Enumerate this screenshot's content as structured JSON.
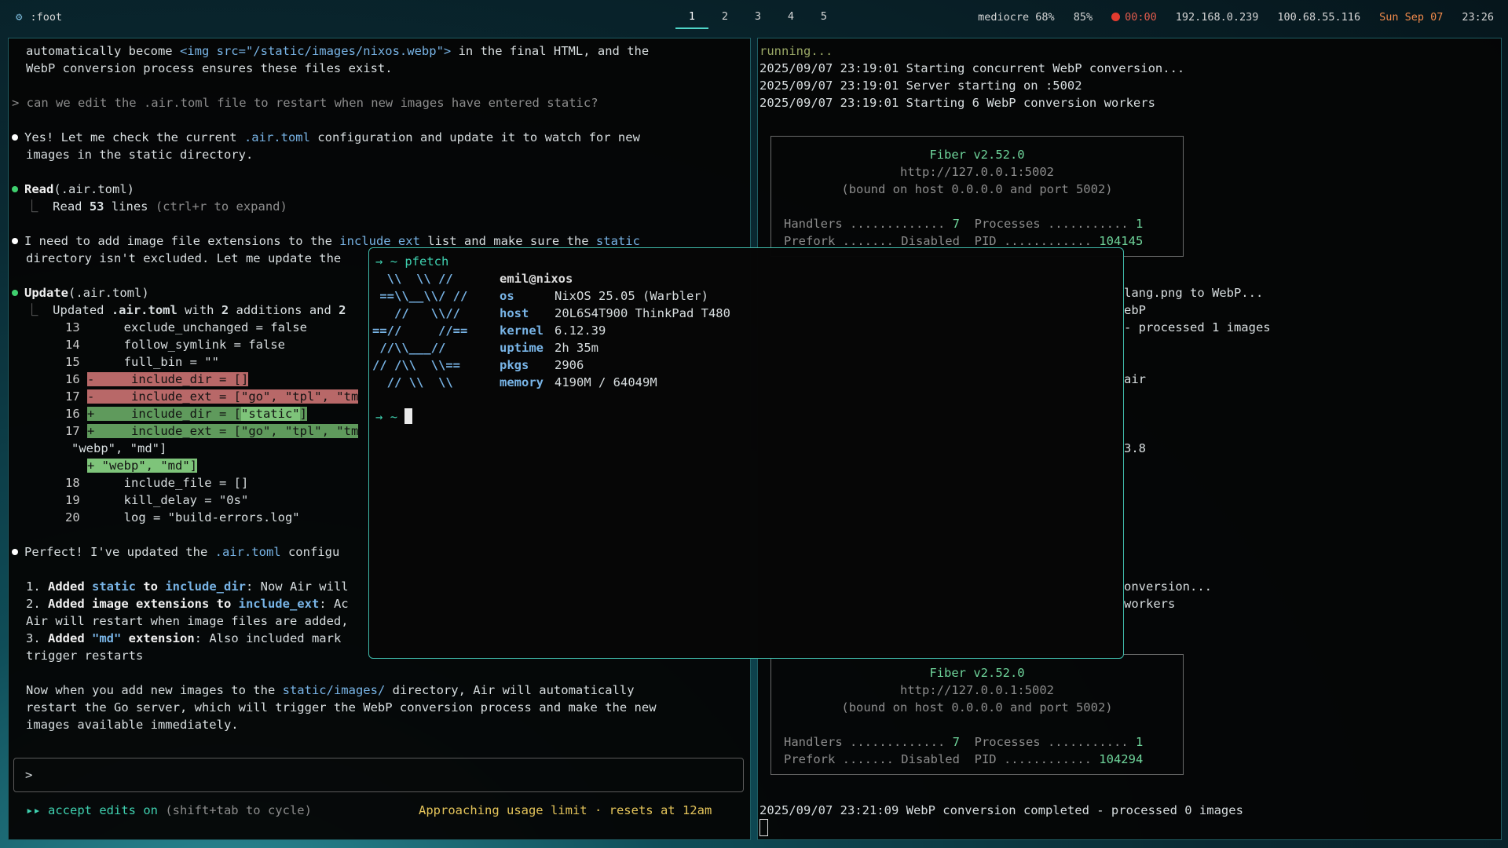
{
  "topbar": {
    "app_title": ":foot",
    "workspaces": [
      "1",
      "2",
      "3",
      "4",
      "5"
    ],
    "active_workspace": 0,
    "status": {
      "battery": "mediocre 68%",
      "volume": "85%",
      "timer": "00:00",
      "ip1": "192.168.0.239",
      "ip2": "100.68.55.116",
      "date": "Sun Sep 07",
      "time": "23:26"
    }
  },
  "left": {
    "l1a": "automatically become ",
    "l1b": "<img src=\"/static/images/nixos.webp\">",
    "l1c": " in the final HTML, and the",
    "l2": "WebP conversion process ensures these files exist.",
    "prompt": "> can we edit the .air.toml file to restart when new images have entered static?",
    "p1a": "Yes! Let me check the current ",
    "p1b": ".air.toml",
    "p1c": " configuration and update it to watch for new",
    "p1d": "images in the static directory.",
    "read_tool": "Read",
    "read_arg": "(.air.toml)",
    "read_result_a": "Read ",
    "read_result_b": "53",
    "read_result_c": " lines ",
    "read_result_d": "(ctrl+r to expand)",
    "p2a": "I need to add image file extensions to the ",
    "p2b": "include_ext",
    "p2c": " list and make sure the ",
    "p2d": "static",
    "p2e": "directory isn't excluded. Let me update the",
    "update_tool": "Update",
    "update_arg": "(.air.toml)",
    "update_a": "Updated ",
    "update_b": ".air.toml",
    "update_c": " with ",
    "update_d": "2",
    "update_e": " additions and ",
    "update_f": "2",
    "diff": [
      {
        "n": "13",
        "t": "      exclude_unchanged = false"
      },
      {
        "n": "14",
        "t": "      follow_symlink = false"
      },
      {
        "n": "15",
        "t": "      full_bin = \"\""
      }
    ],
    "del1_n": "16",
    "del1": "-     include_dir = []",
    "del2_n": "17",
    "del2": "-     include_ext = [\"go\", \"tpl\", \"tm",
    "add1_n": "16",
    "add1a": "+     include_dir = [",
    "add1b": "\"static\"",
    "add1c": "]",
    "add2_n": "17",
    "add2": "+     include_ext = [\"go\", \"tpl\", \"tm",
    "wrap1": "   \"webp\", \"md\"]",
    "wrap2": "+ \"webp\", \"md\"]",
    "diff2": [
      {
        "n": "18",
        "t": "      include_file = []"
      },
      {
        "n": "19",
        "t": "      kill_delay = \"0s\""
      },
      {
        "n": "20",
        "t": "      log = \"build-errors.log\""
      }
    ],
    "p3a": "Perfect! I've updated the ",
    "p3b": ".air.toml",
    "p3c": " configu",
    "li1a": "1. ",
    "li1b": "Added ",
    "li1c": "static",
    "li1d": " to ",
    "li1e": "include_dir",
    "li1f": ": Now Air will",
    "li2a": "2. ",
    "li2b": "Added image extensions to ",
    "li2c": "include_ext",
    "li2d": ": Ac",
    "li2e": "Air will restart when image files are added,",
    "li3a": "3. ",
    "li3b": "Added ",
    "li3c": "\"md\"",
    "li3d": " extension",
    "li3e": ": Also included mark",
    "li3f": "trigger restarts",
    "p4a": "Now when you add new images to the ",
    "p4b": "static/images/",
    "p4c": " directory, Air will automatically",
    "p4d": "restart the Go server, which will trigger the WebP conversion process and make the new",
    "p4e": "images available immediately.",
    "input_prompt": ">",
    "mode_a": "▸▸ ",
    "mode_b": "accept edits on",
    "mode_c": " (shift+tab to cycle)",
    "usage": "Approaching usage limit · resets at 12am"
  },
  "right": {
    "running": "running...",
    "log1": "2025/09/07 23:19:01 Starting concurrent WebP conversion...",
    "log2": "2025/09/07 23:19:01 Server starting on :5002",
    "log3": "2025/09/07 23:19:01 Starting 6 WebP conversion workers",
    "fiber_title": "Fiber v2.52.0",
    "fiber_url": "http://127.0.0.1:5002",
    "fiber_bound": "(bound on host 0.0.0.0 and port 5002)",
    "fiber_h1": "Handlers ............. ",
    "fiber_h1v": "7",
    "fiber_h2": "  Processes ........... ",
    "fiber_h2v": "1",
    "fiber_p1": "Prefork ....... Disabled  PID ............ ",
    "fiber_pid1": "104145",
    "fiber_pid2": "104294",
    "vis_a": "lang.png to WebP...",
    "vis_b": "ebP",
    "vis_c": "- processed 1 images",
    "vis_d": "air",
    "vis_e": "3.8",
    "vis_f": "onversion...",
    "vis_g": "workers",
    "final_log": "2025/09/07 23:21:09 WebP conversion completed - processed 0 images"
  },
  "float": {
    "prompt_sym": "→",
    "cmd": "~ pfetch",
    "logo": [
      "  \\\\  \\\\ //",
      " ==\\\\__\\\\/ //",
      "   //   \\\\//",
      "==//     //==",
      " //\\\\___//",
      "// /\\\\  \\\\==",
      "  // \\\\  \\\\"
    ],
    "user": "emil@nixos",
    "info": [
      {
        "k": "os",
        "v": "NixOS 25.05 (Warbler)"
      },
      {
        "k": "host",
        "v": "20L6S4T900 ThinkPad T480"
      },
      {
        "k": "kernel",
        "v": "6.12.39"
      },
      {
        "k": "uptime",
        "v": "2h 35m"
      },
      {
        "k": "pkgs",
        "v": "2906"
      },
      {
        "k": "memory",
        "v": "4190M / 64049M"
      }
    ],
    "prompt2": "~"
  },
  "colors": {
    "accent": "#3fb9a9",
    "blue": "#78b4e6",
    "green_dot": "#3fcf6e",
    "warning": "#e4c45a"
  }
}
